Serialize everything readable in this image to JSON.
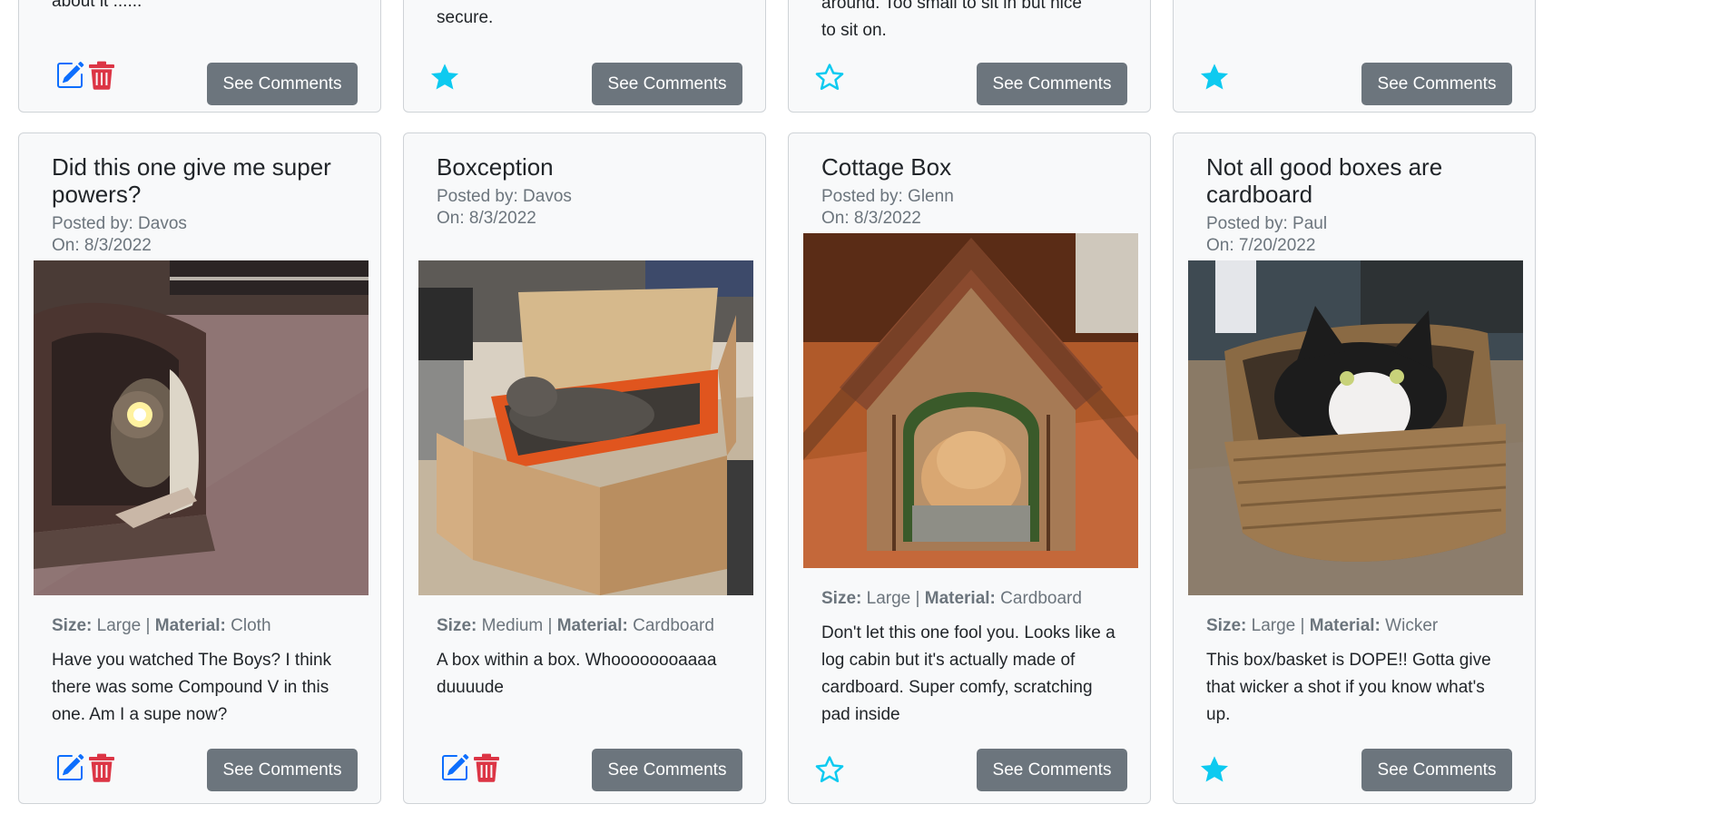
{
  "top_row": [
    {
      "snippet": "about it ......",
      "actions": "edit-delete",
      "comments_label": "See Comments"
    },
    {
      "snippet": "secure.",
      "actions": "star-filled",
      "comments_label": "See Comments"
    },
    {
      "snippet_lines": [
        "around. Too small to sit in but nice",
        "to sit on."
      ],
      "actions": "star-outline",
      "comments_label": "See Comments"
    },
    {
      "snippet": "",
      "actions": "star-filled",
      "comments_label": "See Comments"
    }
  ],
  "cards": [
    {
      "title": "Did this one give me super powers?",
      "posted_by": "Posted by: Davos",
      "posted_on": "On: 8/3/2022",
      "photo": "cat-in-cloth-cave",
      "size_label": "Size:",
      "size": "Large",
      "material_label": "Material:",
      "material": "Cloth",
      "description": "Have you watched The Boys? I think there was some Compound V in this one. Am I a supe now?",
      "actions": "edit-delete",
      "comments_label": "See Comments"
    },
    {
      "title": "Boxception",
      "posted_by": "Posted by: Davos",
      "posted_on": "On: 8/3/2022",
      "photo": "cat-in-box-within-box",
      "size_label": "Size:",
      "size": "Medium",
      "material_label": "Material:",
      "material": "Cardboard",
      "description": "A box within a box. Whoooooooaaaa duuuude",
      "actions": "edit-delete",
      "comments_label": "See Comments"
    },
    {
      "title": "Cottage Box",
      "posted_by": "Posted by: Glenn",
      "posted_on": "On: 8/3/2022",
      "photo": "cat-in-cardboard-cabin",
      "size_label": "Size:",
      "size": "Large",
      "material_label": "Material:",
      "material": "Cardboard",
      "description": "Don't let this one fool you. Looks like a log cabin but it's actually made of cardboard. Super comfy, scratching pad inside",
      "actions": "star-outline",
      "comments_label": "See Comments"
    },
    {
      "title": "Not all good boxes are cardboard",
      "posted_by": "Posted by: Paul",
      "posted_on": "On: 7/20/2022",
      "photo": "cat-in-wicker-basket",
      "size_label": "Size:",
      "size": "Large",
      "material_label": "Material:",
      "material": "Wicker",
      "description": "This box/basket is DOPE!! Gotta give that wicker a shot if you know what's up.",
      "actions": "star-filled",
      "comments_label": "See Comments"
    }
  ],
  "icons": {
    "edit": "edit-icon",
    "delete": "trash-icon",
    "favorite_filled": "star-filled-icon",
    "favorite_outline": "star-outline-icon"
  },
  "colors": {
    "edit": "#0d6efd",
    "delete": "#dc3545",
    "star": "#0dcaf0",
    "button_bg": "#6c757d",
    "card_bg": "#f8f9fa",
    "muted_text": "#6c757d"
  }
}
